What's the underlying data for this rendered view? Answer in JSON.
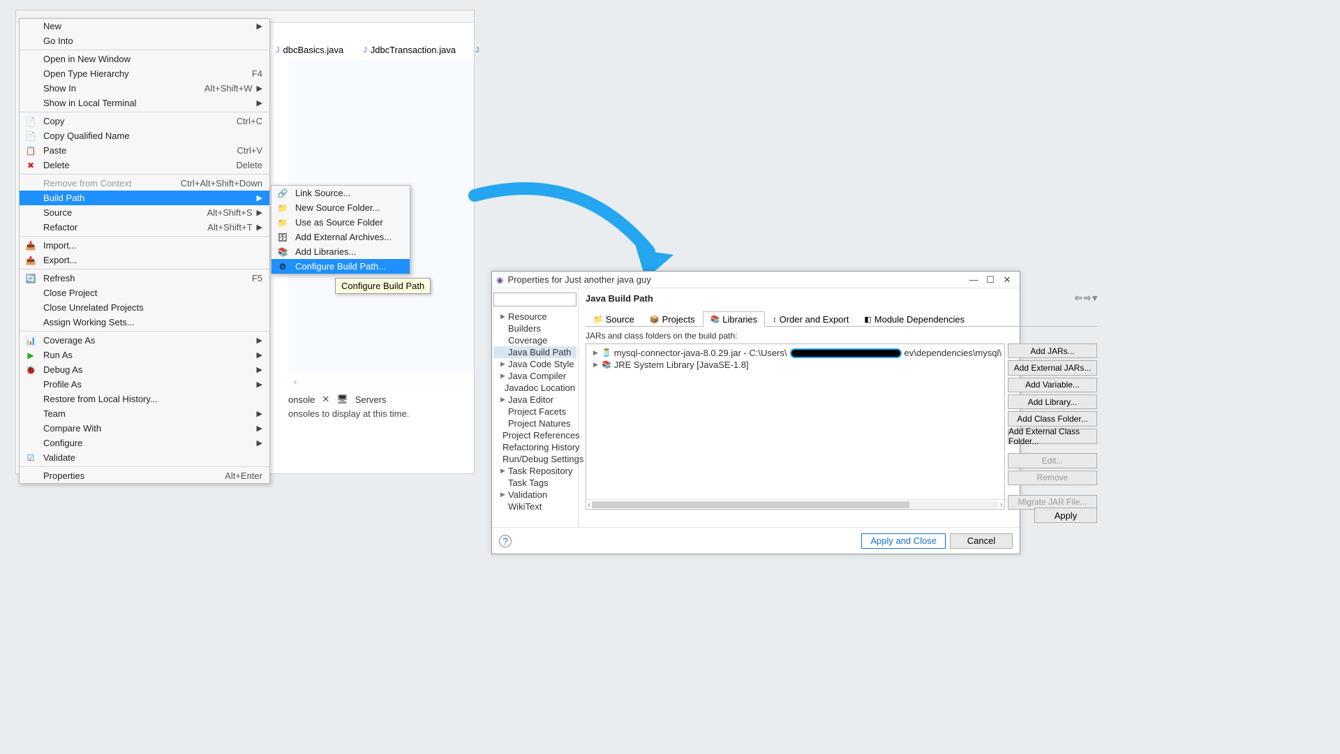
{
  "editor": {
    "tabs": [
      {
        "label": "dbcBasics.java"
      },
      {
        "label": "JdbcTransaction.java"
      }
    ],
    "console_tab": "onsole",
    "servers_tab": "Servers",
    "console_msg": "onsoles to display at this time."
  },
  "menu": [
    {
      "label": "New",
      "arrow": true
    },
    {
      "label": "Go Into"
    },
    {
      "sep": true
    },
    {
      "label": "Open in New Window"
    },
    {
      "label": "Open Type Hierarchy",
      "accel": "F4"
    },
    {
      "label": "Show In",
      "accel": "Alt+Shift+W",
      "arrow": true
    },
    {
      "label": "Show in Local Terminal",
      "arrow": true
    },
    {
      "sep": true
    },
    {
      "label": "Copy",
      "accel": "Ctrl+C",
      "icon": "📄"
    },
    {
      "label": "Copy Qualified Name",
      "icon": "📄"
    },
    {
      "label": "Paste",
      "accel": "Ctrl+V",
      "icon": "📋"
    },
    {
      "label": "Delete",
      "accel": "Delete",
      "icon": "✖",
      "iconColor": "#d22"
    },
    {
      "sep": true
    },
    {
      "label": "Remove from Context",
      "accel": "Ctrl+Alt+Shift+Down",
      "disabled": true
    },
    {
      "label": "Build Path",
      "arrow": true,
      "highlight": true
    },
    {
      "label": "Source",
      "accel": "Alt+Shift+S",
      "arrow": true
    },
    {
      "label": "Refactor",
      "accel": "Alt+Shift+T",
      "arrow": true
    },
    {
      "sep": true
    },
    {
      "label": "Import...",
      "icon": "📥"
    },
    {
      "label": "Export...",
      "icon": "📤"
    },
    {
      "sep": true
    },
    {
      "label": "Refresh",
      "accel": "F5",
      "icon": "🔄"
    },
    {
      "label": "Close Project"
    },
    {
      "label": "Close Unrelated Projects"
    },
    {
      "label": "Assign Working Sets..."
    },
    {
      "sep": true
    },
    {
      "label": "Coverage As",
      "arrow": true,
      "icon": "📊"
    },
    {
      "label": "Run As",
      "arrow": true,
      "icon": "▶",
      "iconColor": "#2a2"
    },
    {
      "label": "Debug As",
      "arrow": true,
      "icon": "🐞"
    },
    {
      "label": "Profile As",
      "arrow": true
    },
    {
      "label": "Restore from Local History..."
    },
    {
      "label": "Team",
      "arrow": true
    },
    {
      "label": "Compare With",
      "arrow": true
    },
    {
      "label": "Configure",
      "arrow": true
    },
    {
      "label": "Validate",
      "icon": "☑",
      "iconColor": "#2a70c0"
    },
    {
      "sep": true
    },
    {
      "label": "Properties",
      "accel": "Alt+Enter"
    }
  ],
  "submenu": [
    {
      "label": "Link Source...",
      "icon": "🔗"
    },
    {
      "label": "New Source Folder...",
      "icon": "📁"
    },
    {
      "sep": true
    },
    {
      "label": "Use as Source Folder",
      "icon": "📁"
    },
    {
      "label": "Add External Archives...",
      "icon": "🗄"
    },
    {
      "label": "Add Libraries...",
      "icon": "📚"
    },
    {
      "sep": true
    },
    {
      "label": "Configure Build Path...",
      "icon": "⚙",
      "highlight": true
    }
  ],
  "tooltip": "Configure Build Path",
  "dialog": {
    "title": "Properties for Just another java guy",
    "search_placeholder": "",
    "heading": "Java Build Path",
    "categories": [
      {
        "label": "Resource",
        "exp": true
      },
      {
        "label": "Builders"
      },
      {
        "label": "Coverage"
      },
      {
        "label": "Java Build Path",
        "sel": true
      },
      {
        "label": "Java Code Style",
        "exp": true
      },
      {
        "label": "Java Compiler",
        "exp": true
      },
      {
        "label": "Javadoc Location"
      },
      {
        "label": "Java Editor",
        "exp": true
      },
      {
        "label": "Project Facets"
      },
      {
        "label": "Project Natures"
      },
      {
        "label": "Project References"
      },
      {
        "label": "Refactoring History"
      },
      {
        "label": "Run/Debug Settings"
      },
      {
        "label": "Task Repository",
        "exp": true
      },
      {
        "label": "Task Tags"
      },
      {
        "label": "Validation",
        "exp": true
      },
      {
        "label": "WikiText"
      }
    ],
    "tabs": [
      {
        "label": "Source",
        "icon": "📁"
      },
      {
        "label": "Projects",
        "icon": "📦"
      },
      {
        "label": "Libraries",
        "icon": "📚",
        "active": true
      },
      {
        "label": "Order and Export",
        "icon": "↕"
      },
      {
        "label": "Module Dependencies",
        "icon": "◧"
      }
    ],
    "jar_label": "JARs and class folders on the build path:",
    "libs": [
      {
        "label_pre": "mysql-connector-java-8.0.29.jar - C:\\Users\\",
        "label_post": "ev\\dependencies\\mysql\\",
        "icon": "🫙",
        "redact": true
      },
      {
        "label": "JRE System Library [JavaSE-1.8]",
        "icon": "📚"
      }
    ],
    "buttons": [
      {
        "label": "Add JARs..."
      },
      {
        "label": "Add External JARs..."
      },
      {
        "label": "Add Variable..."
      },
      {
        "label": "Add Library..."
      },
      {
        "label": "Add Class Folder..."
      },
      {
        "label": "Add External Class Folder..."
      },
      {
        "gap": true
      },
      {
        "label": "Edit...",
        "disabled": true
      },
      {
        "label": "Remove",
        "disabled": true
      },
      {
        "gap": true
      },
      {
        "label": "Migrate JAR File...",
        "disabled": true
      }
    ],
    "apply": "Apply",
    "footer": {
      "apply_close": "Apply and Close",
      "cancel": "Cancel"
    }
  }
}
